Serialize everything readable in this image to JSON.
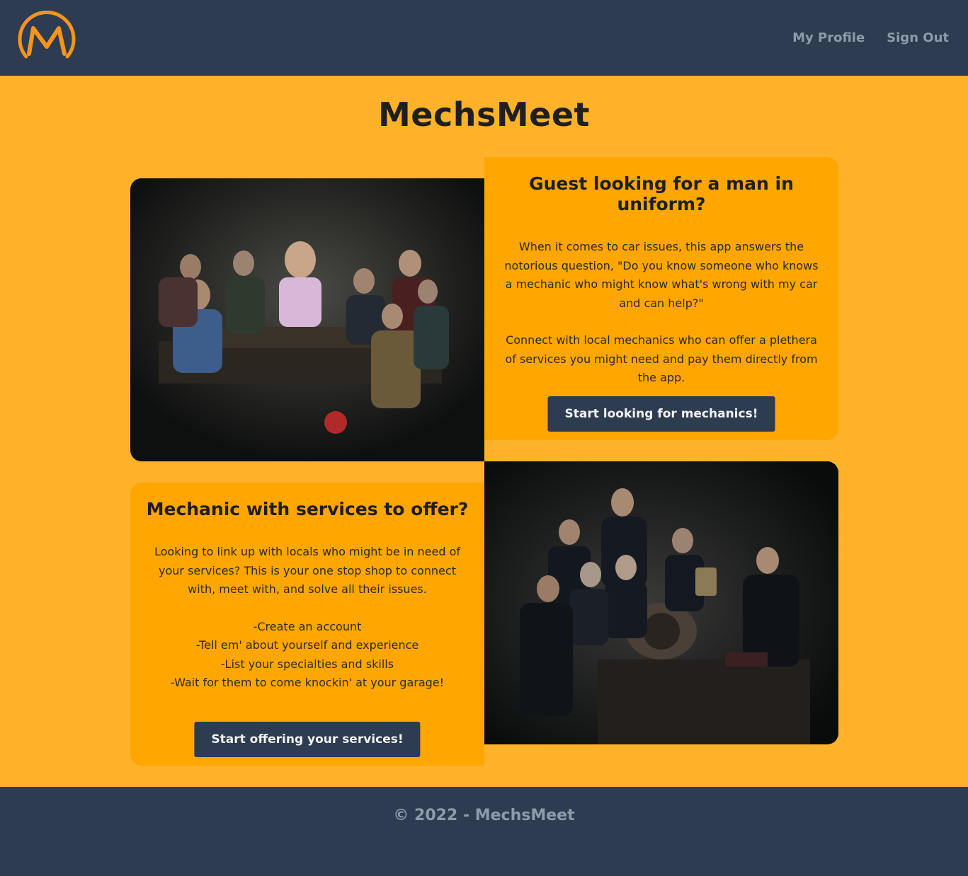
{
  "header": {
    "logo_letter": "M",
    "nav": [
      {
        "label": "My Profile"
      },
      {
        "label": "Sign Out"
      }
    ]
  },
  "main": {
    "title": "MechsMeet",
    "guest_card": {
      "heading": "Guest looking for a man in uniform?",
      "paragraph_1": "When it comes to car issues, this app answers the notorious question, \"Do you know someone who knows a mechanic who might know what's wrong with my car and can help?\"",
      "paragraph_2": "Connect with local mechanics who can offer a plethera of services you might need and pay them directly from the app.",
      "button_label": "Start looking for mechanics!"
    },
    "mechanic_card": {
      "heading": "Mechanic with services to offer?",
      "paragraph_1": "Looking to link up with locals who might be in need of your services? This is your one stop shop to connect with, meet with, and solve all their issues.",
      "list": [
        "-Create an account",
        "-Tell em' about yourself and experience",
        "-List your specialties and skills",
        "-Wait for them to come knockin' at your garage!"
      ],
      "button_label": "Start offering your services!"
    }
  },
  "footer": {
    "text": "© 2022 - MechsMeet"
  },
  "colors": {
    "nav_bg": "#2d3c50",
    "page_bg": "#fdb22a",
    "card_bg": "#ffa600",
    "logo_orange": "#f7941d",
    "muted_text": "#8d9bab"
  }
}
